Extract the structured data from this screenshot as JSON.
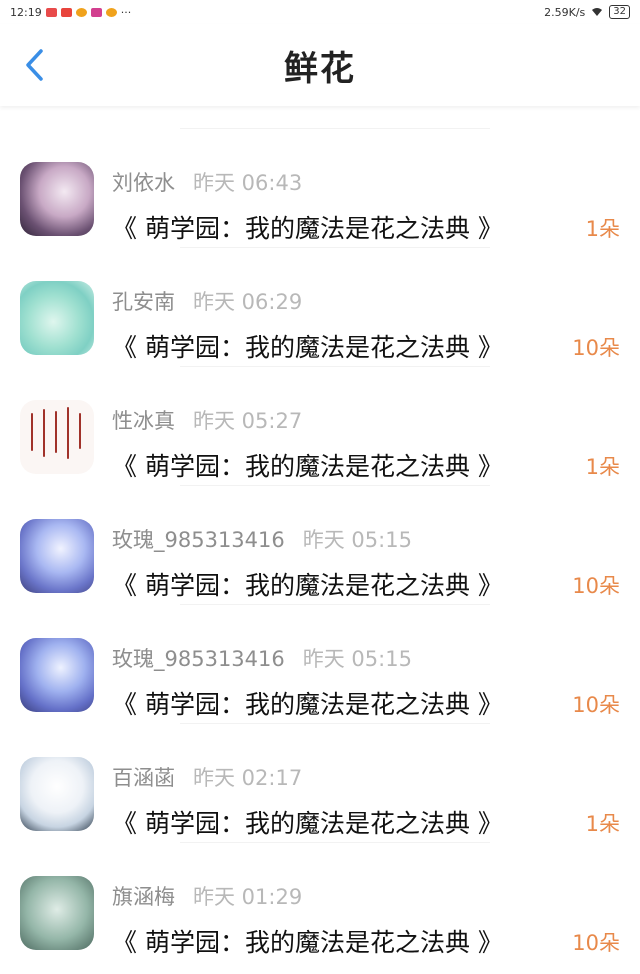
{
  "status": {
    "time": "12:19",
    "more": "···",
    "speed": "2.59K/s",
    "battery": "32"
  },
  "header": {
    "title": "鲜花"
  },
  "items": [
    {
      "name": "刘依水",
      "time": "昨天 06:43",
      "book": "《 萌学园：我的魔法是花之法典 》",
      "amount": "1朵"
    },
    {
      "name": "孔安南",
      "time": "昨天 06:29",
      "book": "《 萌学园：我的魔法是花之法典 》",
      "amount": "10朵"
    },
    {
      "name": "性冰真",
      "time": "昨天 05:27",
      "book": "《 萌学园：我的魔法是花之法典 》",
      "amount": "1朵"
    },
    {
      "name": "玫瑰_985313416",
      "time": "昨天 05:15",
      "book": "《 萌学园：我的魔法是花之法典 》",
      "amount": "10朵"
    },
    {
      "name": "玫瑰_985313416",
      "time": "昨天 05:15",
      "book": "《 萌学园：我的魔法是花之法典 》",
      "amount": "10朵"
    },
    {
      "name": "百涵菡",
      "time": "昨天 02:17",
      "book": "《 萌学园：我的魔法是花之法典 》",
      "amount": "1朵"
    },
    {
      "name": "旗涵梅",
      "time": "昨天 01:29",
      "book": "《 萌学园：我的魔法是花之法典 》",
      "amount": "10朵"
    }
  ],
  "colors": {
    "accent": "#3a8ee6",
    "amount": "#e8894a"
  }
}
